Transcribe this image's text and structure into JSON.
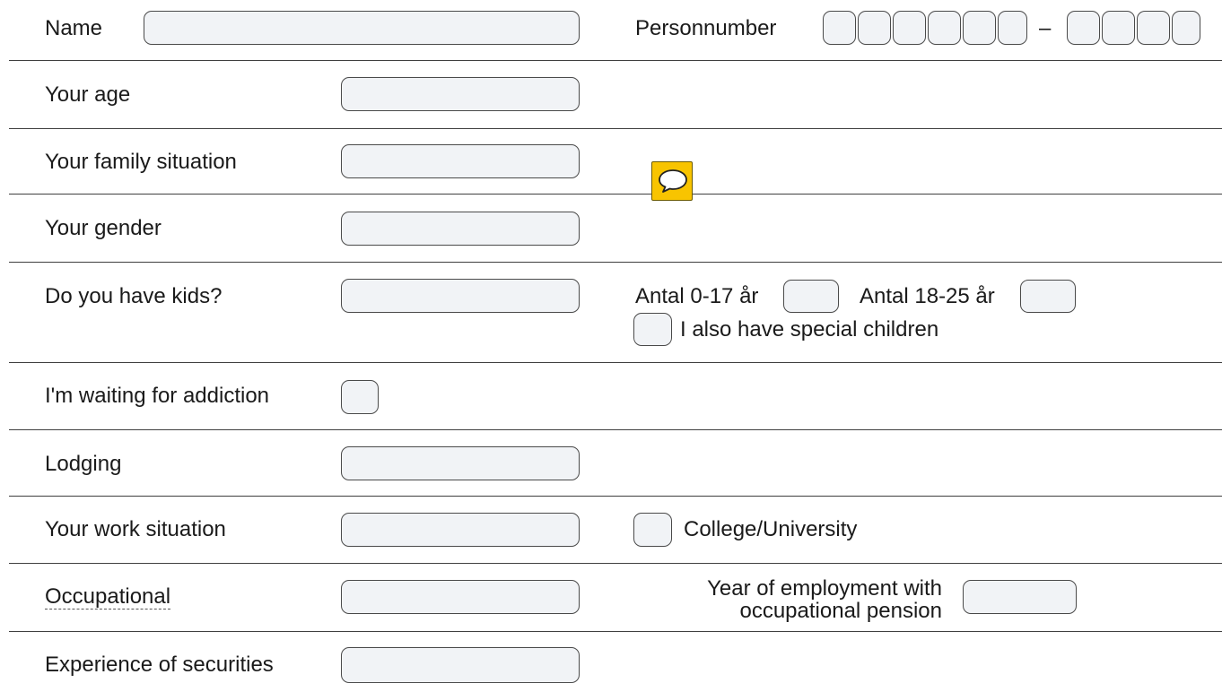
{
  "rows": {
    "name": {
      "label": "Name"
    },
    "personnumber": {
      "label": "Personnumber",
      "dash": "–"
    },
    "age": {
      "label": "Your age"
    },
    "family": {
      "label": "Your family situation"
    },
    "gender": {
      "label": "Your gender"
    },
    "kids": {
      "label": "Do you have kids?",
      "count_0_17_label": "Antal 0-17 år",
      "count_18_25_label": "Antal 18-25 år",
      "special_children_label": "I also have special children"
    },
    "addiction": {
      "label": "I'm waiting for addiction"
    },
    "lodging": {
      "label": "Lodging"
    },
    "work": {
      "label": "Your work situation",
      "college_label": "College/University"
    },
    "occupational": {
      "label": "Occupational",
      "year_label_line1": "Year of employment with",
      "year_label_line2": "occupational pension"
    },
    "securities": {
      "label": "Experience of securities"
    }
  },
  "comment_icon": {
    "icon": "speech-bubble-icon",
    "color": "#f8c400"
  }
}
